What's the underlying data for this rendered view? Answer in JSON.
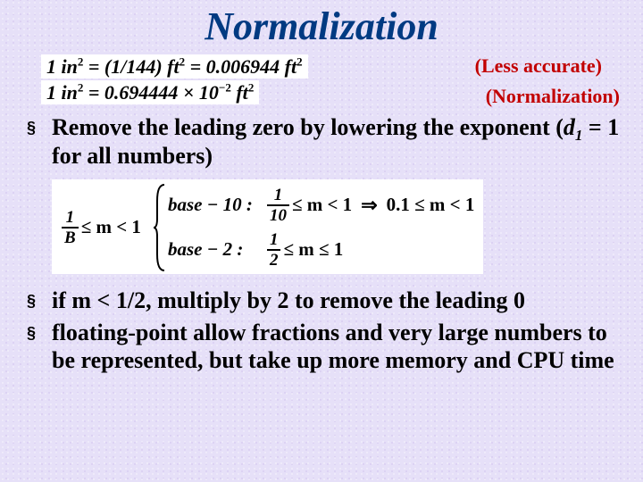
{
  "title": "Normalization",
  "eq1": {
    "lhs": "1 in",
    "sup1": "2",
    "mid": " = (1/144) ft",
    "sup2": "2",
    "tail": " = 0.006944 ft",
    "sup3": "2"
  },
  "eq2": {
    "lhs": "1 in",
    "sup1": "2",
    "mid": " = 0.694444 × 10",
    "sup2": "−2",
    "tail": " ft",
    "sup3": "2"
  },
  "annot1": "(Less accurate)",
  "annot2": "(Normalization)",
  "bullet1": {
    "a": "Remove the leading zero by lowering the exponent (",
    "d": "d",
    "one": "1",
    "b": " = 1 for all numbers)"
  },
  "math": {
    "left_num": "1",
    "left_den": "B",
    "left_tail": " ≤ m < 1",
    "case1_label": "base − 10 :",
    "c1_num": "1",
    "c1_den": "10",
    "c1_tail1": " ≤ m < 1",
    "c1_rhs": "0.1 ≤ m < 1",
    "case2_label": "base − 2 :",
    "c2_num": "1",
    "c2_den": "2",
    "c2_tail": " ≤ m ≤ 1"
  },
  "bullet2": "if m < 1/2, multiply by 2 to remove the leading 0",
  "bullet3": "floating-point allow fractions and very large numbers to be represented, but take up more memory and CPU time"
}
